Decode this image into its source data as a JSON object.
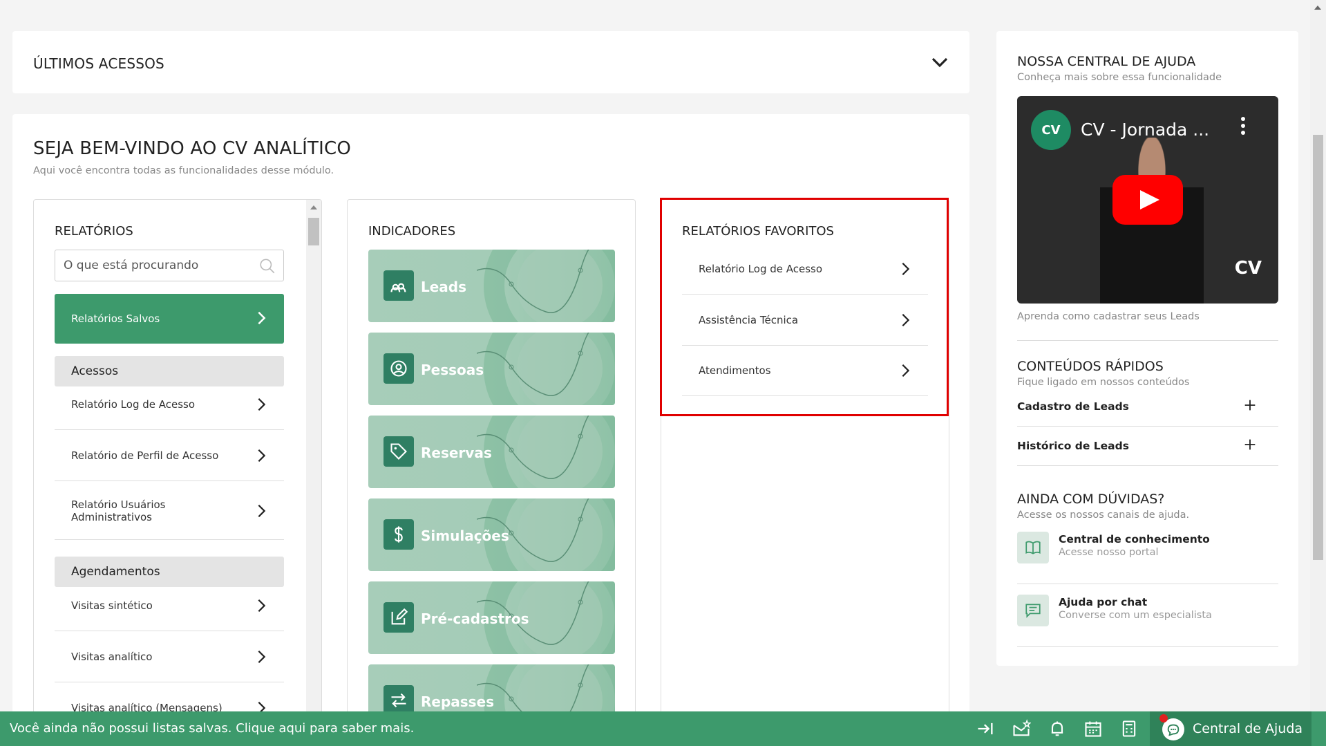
{
  "ultimos": {
    "title": "ÚLTIMOS ACESSOS"
  },
  "welcome": {
    "title": "SEJA BEM-VINDO AO CV ANALÍTICO",
    "subtitle": "Aqui você encontra todas as funcionalidades desse módulo."
  },
  "relatorios": {
    "title": "RELATÓRIOS",
    "search_placeholder": "O que está procurando",
    "saved_label": "Relatórios Salvos",
    "group_acessos": "Acessos",
    "acessos_items": [
      "Relatório Log de Acesso",
      "Relatório de Perfil de Acesso",
      "Relatório Usuários Administrativos"
    ],
    "group_agendamentos": "Agendamentos",
    "agendamentos_items": [
      "Visitas sintético",
      "Visitas analítico",
      "Visitas analítico (Mensagens)"
    ]
  },
  "indicadores": {
    "title": "INDICADORES",
    "items": [
      "Leads",
      "Pessoas",
      "Reservas",
      "Simulações",
      "Pré-cadastros",
      "Repasses"
    ]
  },
  "favoritos": {
    "title": "RELATÓRIOS FAVORITOS",
    "items": [
      "Relatório Log de Acesso",
      "Assistência Técnica",
      "Atendimentos"
    ]
  },
  "help": {
    "title": "NOSSA CENTRAL DE AJUDA",
    "subtitle": "Conheça mais sobre essa funcionalidade",
    "video_title": "CV - Jornada ...",
    "video_logo": "CV",
    "video_caption": "Aprenda como cadastrar seus Leads",
    "quick_title": "CONTEÚDOS RÁPIDOS",
    "quick_subtitle": "Fique ligado em nossos conteúdos",
    "quick_items": [
      "Cadastro de Leads",
      "Histórico de Leads"
    ],
    "doubts_title": "AINDA COM DÚVIDAS?",
    "doubts_subtitle": "Acesse os nossos canais de ajuda.",
    "channels": [
      {
        "title": "Central de conhecimento",
        "subtitle": "Acesse nosso portal"
      },
      {
        "title": "Ajuda por chat",
        "subtitle": "Converse com um especialista"
      }
    ]
  },
  "bottombar": {
    "message": "Você ainda não possui listas salvas. Clique aqui para saber mais.",
    "help_label": "Central de Ajuda"
  },
  "colors": {
    "brand_green": "#3d9a6c",
    "highlight_red": "#e00000"
  }
}
